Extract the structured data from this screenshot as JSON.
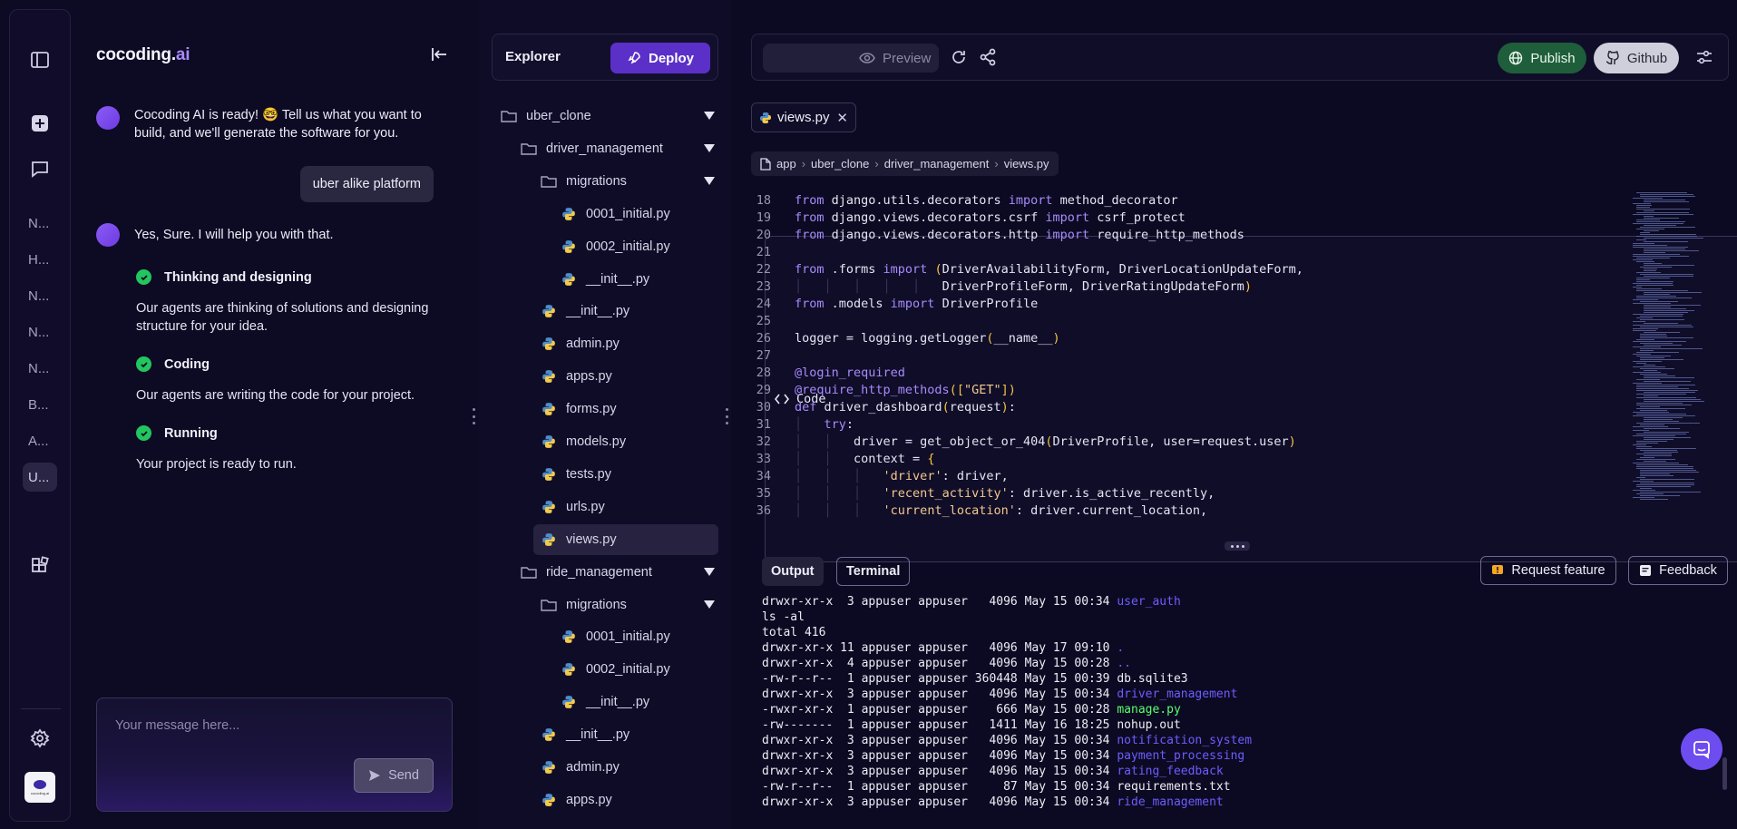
{
  "rail": {
    "projects": [
      "N...",
      "H...",
      "N...",
      "N...",
      "N...",
      "B...",
      "A...",
      "U..."
    ],
    "avatar_text": "cocoding.ai"
  },
  "chat": {
    "logo_main": "cocoding.",
    "logo_ai": "ai",
    "welcome": "Cocoding AI is ready! 🤓 Tell us what you want to build, and we'll generate the software for you.",
    "user_message": "uber alike platform",
    "reply": "Yes, Sure. I will help you with that.",
    "steps": [
      {
        "title": "Thinking and designing",
        "desc": "Our agents are thinking of solutions and designing structure for your idea."
      },
      {
        "title": "Coding",
        "desc": "Our agents are writing the code for your project."
      },
      {
        "title": "Running",
        "desc": "Your project is ready to run."
      }
    ],
    "input_placeholder": "Your message here...",
    "send_label": "Send"
  },
  "explorer": {
    "title": "Explorer",
    "deploy_label": "Deploy",
    "tree": [
      {
        "label": "uber_clone",
        "type": "folder",
        "depth": 0,
        "expanded": true
      },
      {
        "label": "driver_management",
        "type": "folder",
        "depth": 1,
        "expanded": true
      },
      {
        "label": "migrations",
        "type": "folder",
        "depth": 2,
        "expanded": true
      },
      {
        "label": "0001_initial.py",
        "type": "file",
        "depth": 3
      },
      {
        "label": "0002_initial.py",
        "type": "file",
        "depth": 3
      },
      {
        "label": "__init__.py",
        "type": "file",
        "depth": 3
      },
      {
        "label": "__init__.py",
        "type": "file",
        "depth": 2
      },
      {
        "label": "admin.py",
        "type": "file",
        "depth": 2
      },
      {
        "label": "apps.py",
        "type": "file",
        "depth": 2
      },
      {
        "label": "forms.py",
        "type": "file",
        "depth": 2
      },
      {
        "label": "models.py",
        "type": "file",
        "depth": 2
      },
      {
        "label": "tests.py",
        "type": "file",
        "depth": 2
      },
      {
        "label": "urls.py",
        "type": "file",
        "depth": 2
      },
      {
        "label": "views.py",
        "type": "file",
        "depth": 2,
        "active": true
      },
      {
        "label": "ride_management",
        "type": "folder",
        "depth": 1,
        "expanded": true
      },
      {
        "label": "migrations",
        "type": "folder",
        "depth": 2,
        "expanded": true
      },
      {
        "label": "0001_initial.py",
        "type": "file",
        "depth": 3
      },
      {
        "label": "0002_initial.py",
        "type": "file",
        "depth": 3
      },
      {
        "label": "__init__.py",
        "type": "file",
        "depth": 3
      },
      {
        "label": "__init__.py",
        "type": "file",
        "depth": 2
      },
      {
        "label": "admin.py",
        "type": "file",
        "depth": 2
      },
      {
        "label": "apps.py",
        "type": "file",
        "depth": 2
      }
    ]
  },
  "toolbar": {
    "code_label": "Code",
    "preview_label": "Preview",
    "publish_label": "Publish",
    "github_label": "Github"
  },
  "editor": {
    "tab_label": "views.py",
    "breadcrumb": [
      "app",
      "uber_clone",
      "driver_management",
      "views.py"
    ],
    "lines": [
      {
        "n": "18",
        "guides": 0,
        "parts": [
          [
            "kw",
            "from"
          ],
          [
            "tx",
            " django.utils.decorators "
          ],
          [
            "kw",
            "import"
          ],
          [
            "tx",
            " method_decorator"
          ]
        ]
      },
      {
        "n": "19",
        "guides": 0,
        "parts": [
          [
            "kw",
            "from"
          ],
          [
            "tx",
            " django.views.decorators.csrf "
          ],
          [
            "kw",
            "import"
          ],
          [
            "tx",
            " csrf_protect"
          ]
        ]
      },
      {
        "n": "20",
        "guides": 0,
        "parts": [
          [
            "kw",
            "from"
          ],
          [
            "tx",
            " django.views.decorators.http "
          ],
          [
            "kw",
            "import"
          ],
          [
            "tx",
            " require_http_methods"
          ]
        ]
      },
      {
        "n": "21",
        "guides": 0,
        "parts": []
      },
      {
        "n": "22",
        "guides": 0,
        "parts": [
          [
            "kw",
            "from"
          ],
          [
            "tx",
            " .forms "
          ],
          [
            "kw",
            "import"
          ],
          [
            "tx",
            " "
          ],
          [
            "br",
            "("
          ],
          [
            "tx",
            "DriverAvailabilityForm, DriverLocationUpdateForm,"
          ]
        ]
      },
      {
        "n": "23",
        "guides": 5,
        "parts": [
          [
            "tx",
            "DriverProfileForm, DriverRatingUpdateForm"
          ],
          [
            "br",
            ")"
          ]
        ]
      },
      {
        "n": "24",
        "guides": 0,
        "parts": [
          [
            "kw",
            "from"
          ],
          [
            "tx",
            " .models "
          ],
          [
            "kw",
            "import"
          ],
          [
            "tx",
            " DriverProfile"
          ]
        ]
      },
      {
        "n": "25",
        "guides": 0,
        "parts": []
      },
      {
        "n": "26",
        "guides": 0,
        "parts": [
          [
            "tx",
            "logger = logging.getLogger"
          ],
          [
            "br",
            "("
          ],
          [
            "tx",
            "__name__"
          ],
          [
            "br",
            ")"
          ]
        ]
      },
      {
        "n": "27",
        "guides": 0,
        "parts": []
      },
      {
        "n": "28",
        "guides": 0,
        "parts": [
          [
            "dec",
            "@login_required"
          ]
        ]
      },
      {
        "n": "29",
        "guides": 0,
        "parts": [
          [
            "dec",
            "@require_http_methods"
          ],
          [
            "br",
            "(["
          ],
          [
            "st",
            "\"GET\""
          ],
          [
            "br",
            "])"
          ]
        ]
      },
      {
        "n": "30",
        "guides": 0,
        "parts": [
          [
            "kw",
            "def"
          ],
          [
            "tx",
            " driver_dashboard"
          ],
          [
            "br",
            "("
          ],
          [
            "tx",
            "request"
          ],
          [
            "br",
            ")"
          ],
          [
            "tx",
            ":"
          ]
        ]
      },
      {
        "n": "31",
        "guides": 1,
        "parts": [
          [
            "kw",
            "try"
          ],
          [
            "tx",
            ":"
          ]
        ]
      },
      {
        "n": "32",
        "guides": 2,
        "parts": [
          [
            "tx",
            "driver = get_object_or_404"
          ],
          [
            "br",
            "("
          ],
          [
            "tx",
            "DriverProfile, user=request.user"
          ],
          [
            "br",
            ")"
          ]
        ]
      },
      {
        "n": "33",
        "guides": 2,
        "parts": [
          [
            "tx",
            "context = "
          ],
          [
            "br",
            "{"
          ]
        ]
      },
      {
        "n": "34",
        "guides": 3,
        "parts": [
          [
            "st",
            "'driver'"
          ],
          [
            "tx",
            ": driver,"
          ]
        ]
      },
      {
        "n": "35",
        "guides": 3,
        "parts": [
          [
            "st",
            "'recent_activity'"
          ],
          [
            "tx",
            ": driver.is_active_recently,"
          ]
        ]
      },
      {
        "n": "36",
        "guides": 3,
        "parts": [
          [
            "st",
            "'current_location'"
          ],
          [
            "tx",
            ": driver.current_location,"
          ]
        ]
      }
    ]
  },
  "output": {
    "output_tab": "Output",
    "terminal_tab": "Terminal",
    "request_feature": "Request feature",
    "feedback": "Feedback",
    "lines": [
      {
        "text": "drwxr-xr-x  3 appuser appuser   4096 May 15 00:34 ",
        "name": "user_auth",
        "kind": "dir"
      },
      {
        "text": "ls -al",
        "name": "",
        "kind": ""
      },
      {
        "text": "total 416",
        "name": "",
        "kind": ""
      },
      {
        "text": "drwxr-xr-x 11 appuser appuser   4096 May 17 09:10 ",
        "name": ".",
        "kind": "dir"
      },
      {
        "text": "drwxr-xr-x  4 appuser appuser   4096 May 15 00:28 ",
        "name": "..",
        "kind": "dir"
      },
      {
        "text": "-rw-r--r--  1 appuser appuser 360448 May 15 00:39 ",
        "name": "db.sqlite3",
        "kind": ""
      },
      {
        "text": "drwxr-xr-x  3 appuser appuser   4096 May 15 00:34 ",
        "name": "driver_management",
        "kind": "dir"
      },
      {
        "text": "-rwxr-xr-x  1 appuser appuser    666 May 15 00:28 ",
        "name": "manage.py",
        "kind": "exe"
      },
      {
        "text": "-rw-------  1 appuser appuser   1411 May 16 18:25 ",
        "name": "nohup.out",
        "kind": ""
      },
      {
        "text": "drwxr-xr-x  3 appuser appuser   4096 May 15 00:34 ",
        "name": "notification_system",
        "kind": "dir"
      },
      {
        "text": "drwxr-xr-x  3 appuser appuser   4096 May 15 00:34 ",
        "name": "payment_processing",
        "kind": "dir"
      },
      {
        "text": "drwxr-xr-x  3 appuser appuser   4096 May 15 00:34 ",
        "name": "rating_feedback",
        "kind": "dir"
      },
      {
        "text": "-rw-r--r--  1 appuser appuser     87 May 15 00:34 ",
        "name": "requirements.txt",
        "kind": ""
      },
      {
        "text": "drwxr-xr-x  3 appuser appuser   4096 May 15 00:34 ",
        "name": "ride_management",
        "kind": "dir"
      }
    ]
  }
}
